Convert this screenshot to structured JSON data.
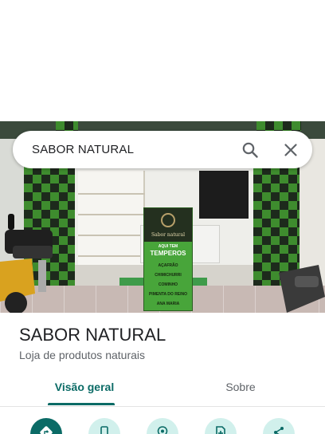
{
  "search": {
    "query": "SABOR NATURAL"
  },
  "place": {
    "name": "SABOR NATURAL",
    "category": "Loja de produtos naturais"
  },
  "tabs": [
    {
      "label": "Visão geral",
      "selected": true
    },
    {
      "label": "Sobre",
      "selected": false
    }
  ],
  "photo_sign": {
    "brand": "Sabor natural",
    "heading_small": "AQUI TEM",
    "heading": "TEMPEROS",
    "items": [
      "AÇAFRÃO",
      "CHIMICHURRI",
      "COMINHO",
      "PIMENTA DO REINO",
      "ANA MARIA"
    ]
  },
  "actions": [
    {
      "icon": "directions-icon"
    },
    {
      "icon": "phone-icon"
    },
    {
      "icon": "save-place-icon"
    },
    {
      "icon": "add-photo-icon"
    },
    {
      "icon": "share-icon"
    }
  ],
  "colors": {
    "accent": "#0b6b66",
    "action_bg": "#d1f0ec",
    "text_primary": "#202124",
    "text_secondary": "#5f6368"
  }
}
